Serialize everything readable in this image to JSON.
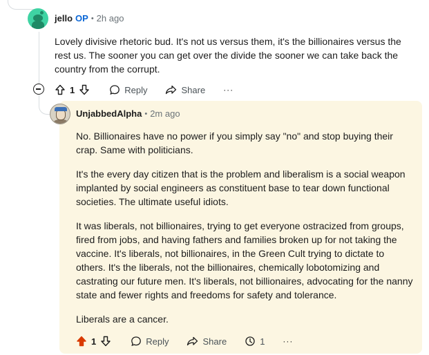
{
  "parent_comment": {
    "author": "jello",
    "op_badge": "OP",
    "separator": "•",
    "time": "2h ago",
    "text": "Lovely divisive rhetoric bud. It's not us versus them, it's the billionaires versus the rest us. The sooner you can get over the divide the sooner we can take back the country from the corrupt.",
    "vote_count": "1",
    "reply_label": "Reply",
    "share_label": "Share",
    "more_label": "···"
  },
  "reply_comment": {
    "author": "UnjabbedAlpha",
    "separator": "•",
    "time": "2m ago",
    "paragraphs": [
      "No. Billionaires have no power if you simply say \"no\" and stop buying their crap. Same with politicians.",
      "It's the every day citizen that is the problem and liberalism is a social weapon implanted by social engineers as constituent base to tear down functional societies. The ultimate useful idiots.",
      "It was liberals, not billionaires, trying to get everyone ostracized from groups, fired from jobs, and having fathers and families broken up for not taking the vaccine. It's liberals, not billionaires, in the Green Cult trying to dictate to others. It's the liberals, not the billionaires, chemically lobotomizing and castrating our future men. It's liberals, not billionaires, advocating for the nanny state and fewer rights and freedoms for safety and tolerance.",
      "Liberals are a cancer."
    ],
    "vote_count": "1",
    "reply_label": "Reply",
    "share_label": "Share",
    "award_count": "1",
    "more_label": "···"
  },
  "colors": {
    "op_blue": "#0a66d6",
    "upvote_orange": "#d93a00",
    "highlight_bg": "#fcf6e2",
    "avatar_green": "#3fd3a3"
  },
  "icons": {
    "upvote": "upvote-icon",
    "downvote": "downvote-icon",
    "reply": "comment-bubble-icon",
    "share": "share-arrow-icon",
    "award": "award-icon",
    "collapse": "collapse-minus-icon"
  }
}
